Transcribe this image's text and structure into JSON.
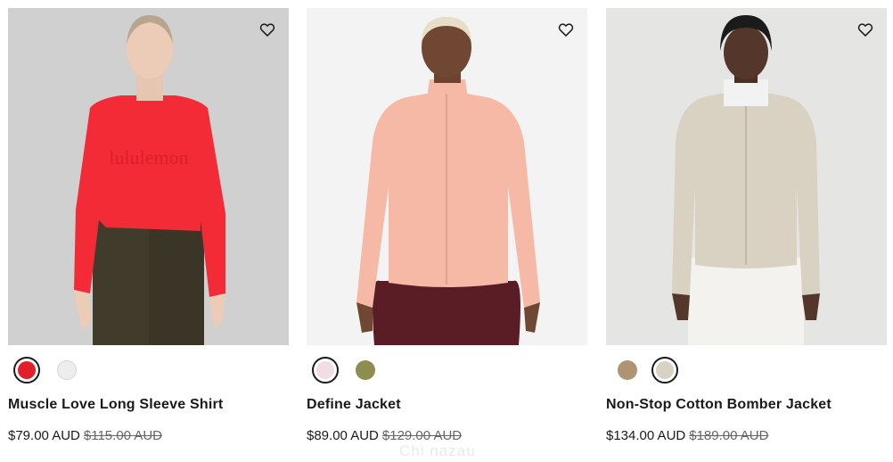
{
  "products": [
    {
      "name": "Muscle Love Long Sleeve Shirt",
      "price": "$79.00 AUD",
      "was_price": "$115.00 AUD",
      "wishlist_icon": "heart-outline-icon",
      "swatches": [
        {
          "color": "#e01f2b",
          "selected": true
        },
        {
          "color": "#ededed",
          "selected": false
        }
      ]
    },
    {
      "name": "Define Jacket",
      "price": "$89.00 AUD",
      "was_price": "$129.00 AUD",
      "wishlist_icon": "heart-outline-icon",
      "swatches": [
        {
          "color": "#f3dde4",
          "selected": true
        },
        {
          "color": "#8e8c4e",
          "selected": false
        }
      ]
    },
    {
      "name": "Non-Stop Cotton Bomber Jacket",
      "price": "$134.00 AUD",
      "was_price": "$189.00 AUD",
      "wishlist_icon": "heart-outline-icon",
      "swatches": [
        {
          "color": "#ae9474",
          "selected": false
        },
        {
          "color": "#d8d2c4",
          "selected": true
        }
      ]
    }
  ],
  "partial_text": "Chi nazau",
  "colors": {
    "accent": "#e01f2b",
    "text": "#1a1a1a",
    "strike": "#666666"
  }
}
